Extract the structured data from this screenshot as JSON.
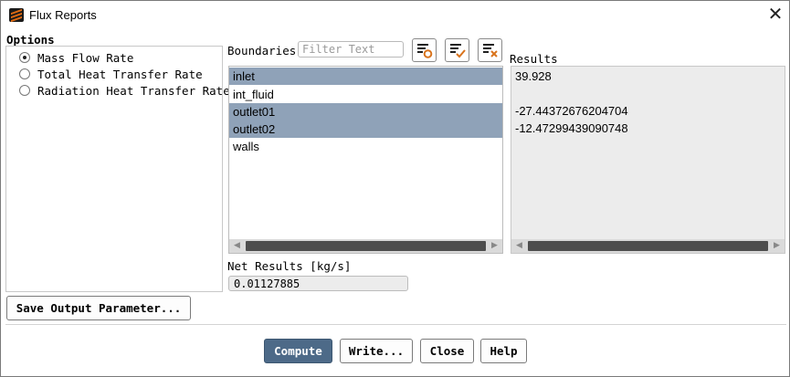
{
  "window": {
    "title": "Flux Reports",
    "app_icon": "fluent-logo-icon",
    "close_glyph": "✕"
  },
  "options": {
    "title": "Options",
    "items": [
      {
        "label": "Mass Flow Rate",
        "selected": true
      },
      {
        "label": "Total Heat Transfer Rate",
        "selected": false
      },
      {
        "label": "Radiation Heat Transfer Rate",
        "selected": false
      }
    ]
  },
  "boundaries": {
    "label": "Boundaries",
    "filter_placeholder": "Filter Text",
    "toolbar": [
      "filter-settings-icon",
      "select-all-icon",
      "deselect-all-icon"
    ],
    "items": [
      {
        "name": "inlet",
        "selected": true
      },
      {
        "name": "int_fluid",
        "selected": false
      },
      {
        "name": "outlet01",
        "selected": true
      },
      {
        "name": "outlet02",
        "selected": true
      },
      {
        "name": "walls",
        "selected": false
      }
    ]
  },
  "results": {
    "label": "Results",
    "lines": [
      "39.928",
      "",
      "-27.44372676204704",
      "-12.47299439090748"
    ]
  },
  "net": {
    "label": "Net Results [kg/s]",
    "value": "0.01127885"
  },
  "save_button": "Save Output Parameter...",
  "buttons": {
    "compute": "Compute",
    "write": "Write...",
    "close": "Close",
    "help": "Help"
  },
  "colors": {
    "selection": "#8fa2b8",
    "primary_button": "#4d6a88"
  }
}
